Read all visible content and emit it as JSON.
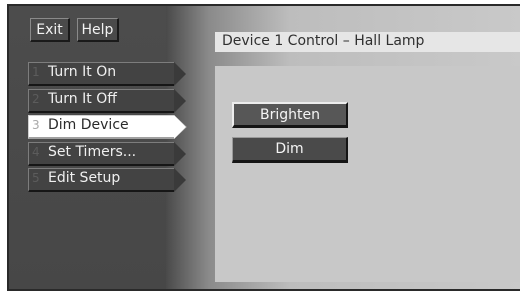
{
  "top_buttons": {
    "exit_label": "Exit",
    "help_label": "Help"
  },
  "menu": {
    "items": [
      {
        "number": "1",
        "label": "Turn It On",
        "selected": false
      },
      {
        "number": "2",
        "label": "Turn It Off",
        "selected": false
      },
      {
        "number": "3",
        "label": "Dim Device",
        "selected": true
      },
      {
        "number": "4",
        "label": "Set Timers...",
        "selected": false
      },
      {
        "number": "5",
        "label": "Edit Setup",
        "selected": false
      }
    ]
  },
  "panel": {
    "title": "Device 1 Control –  Hall Lamp",
    "brighten_label": "Brighten",
    "dim_label": "Dim"
  },
  "colors": {
    "sidebar_bg": "#4c4c4c",
    "button_bg": "#4a4a4a",
    "selected_item_bg": "#ffffff",
    "content_bg": "#c8c8c8",
    "titlebar_bg": "#e6e6e6"
  }
}
